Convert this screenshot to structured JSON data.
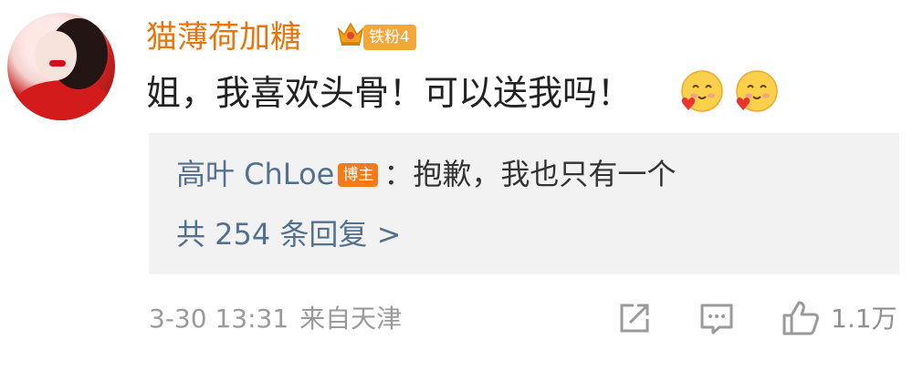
{
  "comment": {
    "username": "猫薄荷加糖",
    "fan_badge": "铁粉4",
    "text": "姐，我喜欢头骨！可以送我吗！",
    "emojis": [
      "smiling-love-heart-emoji",
      "smiling-love-heart-emoji"
    ]
  },
  "reply_preview": {
    "author": "高叶 ChLoe",
    "author_badge": "博主",
    "separator": "：",
    "text": "抱歉，我也只有一个",
    "more_replies": "共 254 条回复 >"
  },
  "meta": {
    "timestamp": "3-30 13:31",
    "source": "来自天津"
  },
  "actions": {
    "share_icon": "share-icon",
    "comment_icon": "comment-icon",
    "like_icon": "thumbs-up-icon",
    "like_count": "1.1万"
  },
  "colors": {
    "username": "#e8740c",
    "link_blue": "#54708f",
    "reply_bg": "#f2f2f2",
    "meta_gray": "#9a9a9a"
  }
}
